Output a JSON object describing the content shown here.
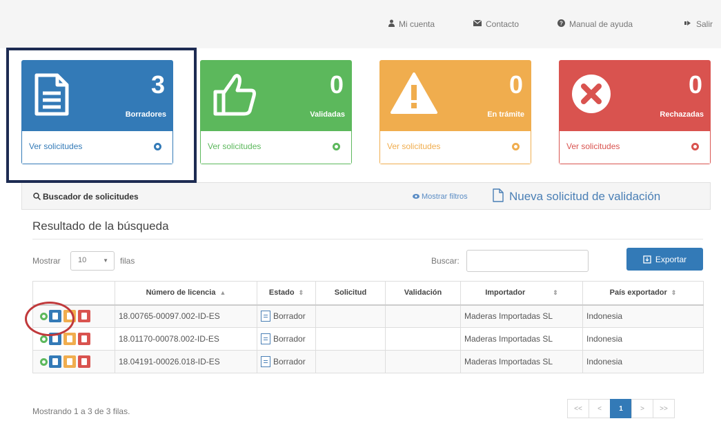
{
  "topnav": {
    "account": "Mi cuenta",
    "contact": "Contacto",
    "manual": "Manual de ayuda",
    "logout": "Salir"
  },
  "cards": {
    "drafts": {
      "count": "3",
      "label": "Borradores",
      "link": "Ver solicitudes",
      "color": "#337ab7"
    },
    "validated": {
      "count": "0",
      "label": "Validadas",
      "link": "Ver solicitudes",
      "color": "#5cb85c"
    },
    "in_process": {
      "count": "0",
      "label": "En trámite",
      "link": "Ver solicitudes",
      "color": "#f0ad4e"
    },
    "rejected": {
      "count": "0",
      "label": "Rechazadas",
      "link": "Ver solicitudes",
      "color": "#d9534f"
    }
  },
  "panel": {
    "title": "Buscador de solicitudes",
    "filters": "Mostrar filtros",
    "new_request": "Nueva solicitud de validación"
  },
  "results": {
    "title": "Resultado de la búsqueda",
    "show_label": "Mostrar",
    "page_size": "10",
    "rows_label": "filas",
    "search_label": "Buscar:",
    "search_value": "",
    "export_label": "Exportar"
  },
  "table": {
    "columns": {
      "license": "Número de licencia",
      "status": "Estado",
      "request": "Solicitud",
      "validation": "Validación",
      "importer": "Importador",
      "country": "País exportador"
    },
    "rows": [
      {
        "license": "18.00765-00097.002-ID-ES",
        "status": "Borrador",
        "request": "",
        "validation": "",
        "importer": "Maderas Importadas SL",
        "country": "Indonesia"
      },
      {
        "license": "18.01170-00078.002-ID-ES",
        "status": "Borrador",
        "request": "",
        "validation": "",
        "importer": "Maderas Importadas SL",
        "country": "Indonesia"
      },
      {
        "license": "18.04191-00026.018-ID-ES",
        "status": "Borrador",
        "request": "",
        "validation": "",
        "importer": "Maderas Importadas SL",
        "country": "Indonesia"
      }
    ]
  },
  "footer": {
    "showing": "Mostrando 1 a 3 de 3 filas.",
    "pager": {
      "first": "<<",
      "prev": "<",
      "current": "1",
      "next": ">",
      "last": ">>"
    }
  },
  "icons": {
    "account": "user-icon",
    "contact": "envelope-icon",
    "manual": "help-circle-icon",
    "logout": "sign-out-icon"
  }
}
